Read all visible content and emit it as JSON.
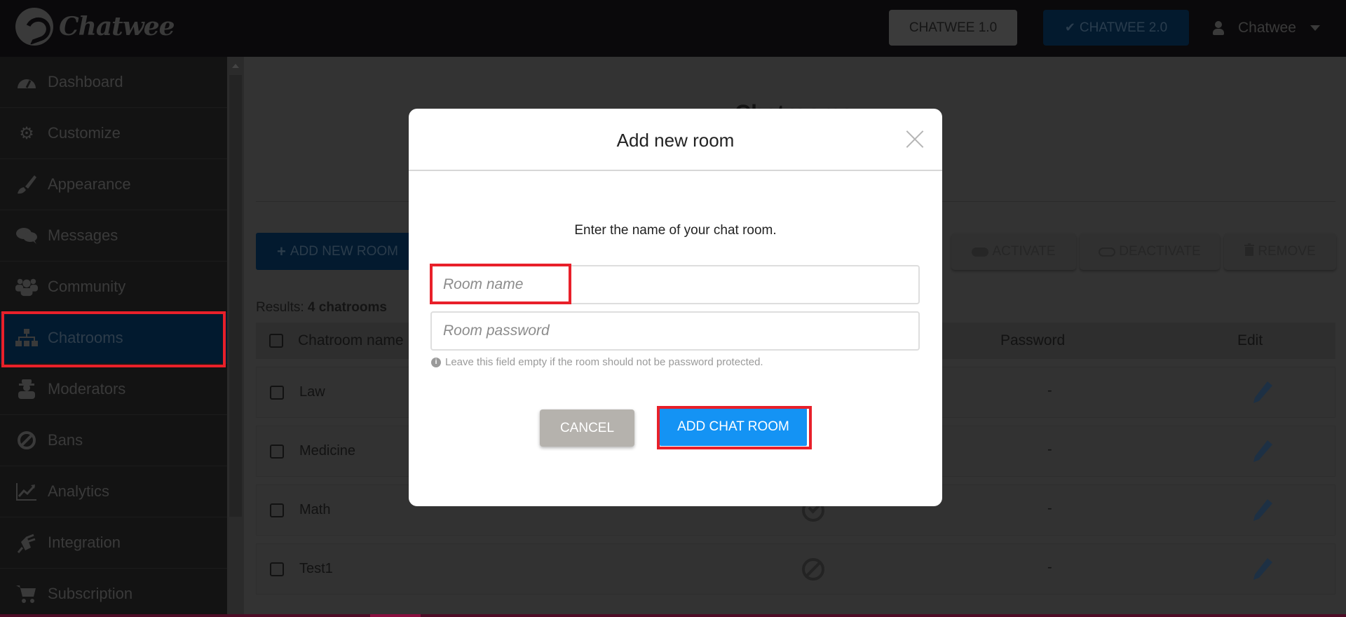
{
  "app": {
    "logo_text": "Chatwee",
    "version_buttons": [
      {
        "label": "CHATWEE 1.0",
        "selected": false
      },
      {
        "label": "CHATWEE 2.0",
        "selected": true
      }
    ],
    "user_menu": {
      "label": "Chatwee",
      "icon": "user-icon"
    }
  },
  "sidebar": {
    "items": [
      {
        "label": "Dashboard",
        "icon": "tachometer-icon",
        "active": false
      },
      {
        "label": "Customize",
        "icon": "gear-wrench-icon",
        "active": false
      },
      {
        "label": "Appearance",
        "icon": "paintbrush-icon",
        "active": false
      },
      {
        "label": "Messages",
        "icon": "comments-icon",
        "active": false
      },
      {
        "label": "Community",
        "icon": "users-icon",
        "active": false
      },
      {
        "label": "Chatrooms",
        "icon": "sitemap-icon",
        "active": true
      },
      {
        "label": "Moderators",
        "icon": "user-secret-icon",
        "active": false
      },
      {
        "label": "Bans",
        "icon": "ban-icon",
        "active": false
      },
      {
        "label": "Analytics",
        "icon": "line-chart-icon",
        "active": false
      },
      {
        "label": "Integration",
        "icon": "plug-icon",
        "active": false
      },
      {
        "label": "Subscription",
        "icon": "cart-icon",
        "active": false
      }
    ]
  },
  "main": {
    "page_title": "Chatrooms",
    "add_room_label": "ADD NEW ROOM",
    "actions": {
      "activate": "ACTIVATE",
      "deactivate": "DEACTIVATE",
      "remove": "REMOVE"
    },
    "results_prefix": "Results:",
    "results_count": "4 chatrooms",
    "table": {
      "columns": [
        "Chatroom name",
        "Password",
        "Edit"
      ],
      "rows": [
        {
          "name": "Law",
          "status": "active",
          "password": "-"
        },
        {
          "name": "Medicine",
          "status": "active",
          "password": "-"
        },
        {
          "name": "Math",
          "status": "active",
          "password": "-"
        },
        {
          "name": "Test1",
          "status": "inactive",
          "password": "-"
        }
      ]
    }
  },
  "modal": {
    "title": "Add new room",
    "description": "Enter the name of your chat room.",
    "room_name_placeholder": "Room name",
    "room_name_value": "",
    "room_password_placeholder": "Room password",
    "room_password_value": "",
    "hint": "Leave this field empty if the room should not be password protected.",
    "cancel_label": "CANCEL",
    "submit_label": "ADD CHAT ROOM"
  },
  "colors": {
    "accent": "#1493f4",
    "highlight": "#e8202a",
    "cancel": "#b5b2ad"
  }
}
